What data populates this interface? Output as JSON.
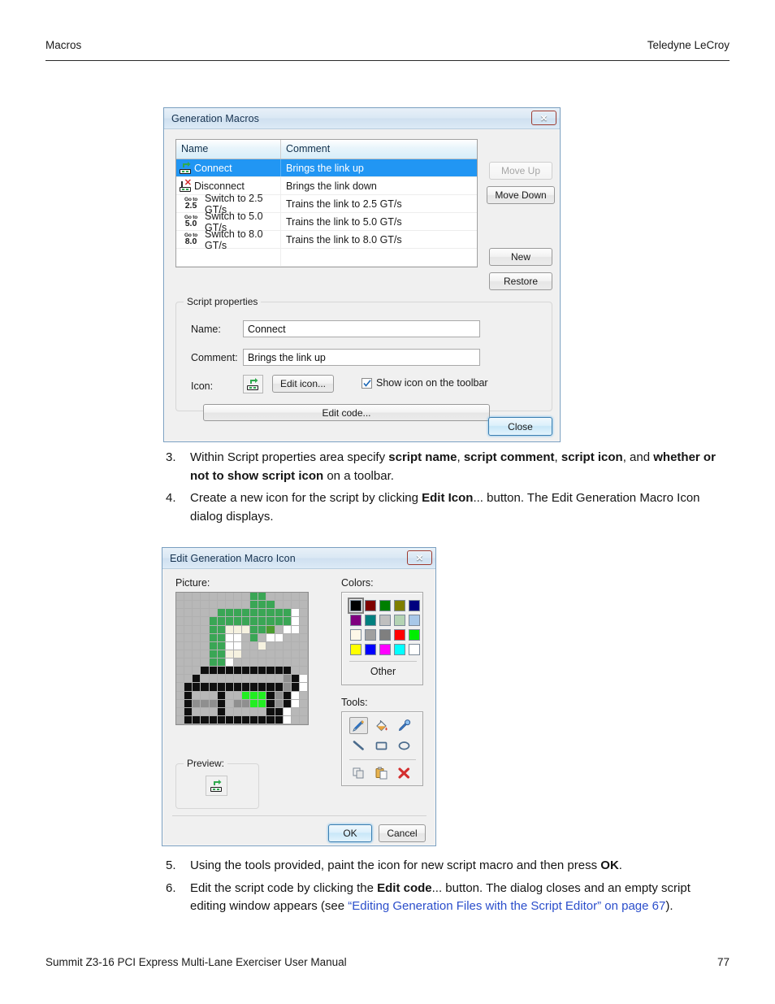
{
  "page": {
    "header_left": "Macros",
    "header_right": "Teledyne LeCroy",
    "footer_left": "Summit Z3-16 PCI Express Multi-Lane Exerciser User Manual",
    "footer_right": "77"
  },
  "steps_block1": [
    {
      "num": "3.",
      "parts": [
        {
          "t": "Within Script properties area specify ",
          "b": false
        },
        {
          "t": "script name",
          "b": true
        },
        {
          "t": ", ",
          "b": false
        },
        {
          "t": "script comment",
          "b": true
        },
        {
          "t": ", ",
          "b": false
        },
        {
          "t": "script icon",
          "b": true
        },
        {
          "t": ", and ",
          "b": false
        },
        {
          "t": "whether or not to show script icon",
          "b": true
        },
        {
          "t": " on a toolbar.",
          "b": false
        }
      ]
    },
    {
      "num": "4.",
      "parts": [
        {
          "t": "Create a new icon for the script by clicking ",
          "b": false
        },
        {
          "t": "Edit Icon",
          "b": true
        },
        {
          "t": "... button. The Edit Generation Macro Icon dialog displays.",
          "b": false
        }
      ]
    }
  ],
  "steps_block2": [
    {
      "num": "5.",
      "parts": [
        {
          "t": "Using the tools provided, paint the icon for new script macro and then press ",
          "b": false
        },
        {
          "t": "OK",
          "b": true
        },
        {
          "t": ".",
          "b": false
        }
      ]
    },
    {
      "num": "6.",
      "parts": [
        {
          "t": "Edit the script code by clicking the ",
          "b": false
        },
        {
          "t": "Edit code",
          "b": true
        },
        {
          "t": "... button. The dialog closes and an empty script editing window appears (see ",
          "b": false
        },
        {
          "t": "“Editing Generation Files with the Script Editor” on page 67",
          "b": false,
          "link": true
        },
        {
          "t": ").",
          "b": false
        }
      ]
    }
  ],
  "generation_macros_dialog": {
    "title": "Generation Macros",
    "close_button_label": "✕",
    "table": {
      "columns": [
        "Name",
        "Comment"
      ],
      "rows": [
        {
          "icon": "connect-icon",
          "name": "Connect",
          "comment": "Brings the link up",
          "selected": true
        },
        {
          "icon": "disconnect-icon",
          "name": "Disconnect",
          "comment": "Brings the link down",
          "selected": false
        },
        {
          "icon": "goto-2.5-icon",
          "name": "Switch to 2.5 GT/s",
          "comment": "Trains the link to 2.5 GT/s",
          "selected": false,
          "goto_top": "Go to",
          "goto_val": "2.5"
        },
        {
          "icon": "goto-5.0-icon",
          "name": "Switch to 5.0 GT/s",
          "comment": "Trains the link to 5.0 GT/s",
          "selected": false,
          "goto_top": "Go to",
          "goto_val": "5.0"
        },
        {
          "icon": "goto-8.0-icon",
          "name": "Switch to 8.0 GT/s",
          "comment": "Trains the link to 8.0 GT/s",
          "selected": false,
          "goto_top": "Go to",
          "goto_val": "8.0"
        }
      ]
    },
    "buttons": {
      "move_up": "Move Up",
      "move_up_disabled": true,
      "move_down": "Move Down",
      "new": "New",
      "restore": "Restore",
      "close": "Close"
    },
    "script_properties": {
      "legend": "Script properties",
      "name_label": "Name:",
      "name_value": "Connect",
      "comment_label": "Comment:",
      "comment_value": "Brings the link up",
      "icon_label": "Icon:",
      "edit_icon_button": "Edit icon...",
      "show_icon_checkbox": "Show icon on the toolbar",
      "show_icon_checked": true,
      "edit_code_button": "Edit code..."
    }
  },
  "edit_icon_dialog": {
    "title": "Edit Generation Macro Icon",
    "close_button_label": "✕",
    "picture_label": "Picture:",
    "preview_label": "Preview:",
    "colors_label": "Colors:",
    "tools_label": "Tools:",
    "other_button": "Other",
    "ok_button": "OK",
    "cancel_button": "Cancel",
    "palette": [
      "#000000",
      "#7f0000",
      "#007f00",
      "#7f7f00",
      "#00007f",
      "#7f007f",
      "#007f7f",
      "#bfbfbf",
      "#b4d3b4",
      "#a8c8e8",
      "#fdf8e8",
      "#a0a0a0",
      "#7f7f7f",
      "#ff0000",
      "#00ee00",
      "#ffff00",
      "#0000ff",
      "#ff00ff",
      "#00ffff",
      "#ffffff"
    ],
    "selected_palette_index": 0,
    "tools": [
      {
        "name": "pencil-tool",
        "selected": true
      },
      {
        "name": "fill-tool",
        "selected": false
      },
      {
        "name": "eyedropper-tool",
        "selected": false
      },
      {
        "name": "line-tool",
        "selected": false
      },
      {
        "name": "rectangle-tool",
        "selected": false
      },
      {
        "name": "ellipse-tool",
        "selected": false
      },
      {
        "name": "copy-tool",
        "selected": false
      },
      {
        "name": "paste-tool",
        "selected": false
      },
      {
        "name": "delete-tool",
        "selected": false
      }
    ],
    "grid_size": 16,
    "pixel_colors": {
      "T": "#b8b8b8",
      "G": "#3aa655",
      "g": "#55bb6e",
      "D": "#4a9d2f",
      "K": "#0f0f0f",
      "W": "#ffffff",
      "C": "#f6f2e0",
      "S": "#8f8f8f",
      "L": "#22ee22"
    },
    "pixels": [
      "TTTTTTTTTGGTTTTT",
      "TTTTTTTTTGGGTTTT",
      "TTTTTGGGGGGGGGWT",
      "TTTTGGGGGGGGGGWT",
      "TTTTGGCCCGGDTWWT",
      "TTTTGGWWTGTWWTTT",
      "TTTTGGWWTTCTTTTT",
      "TTTTGGCCTTTTTTTT",
      "TTTTGGWTTTTTTTTT",
      "TTTKKKKKKKKKKKTT",
      "TTKTTTTTTTTTTSKW",
      "TKKKKKKKKKKKKSKW",
      "TKTTTKTTLLLKSKWT",
      "TKSSSKTSSLLKSKWT",
      "TKTTTKTTTTTKKWTT",
      "TKKKKKKKKKKKKWTT"
    ]
  }
}
